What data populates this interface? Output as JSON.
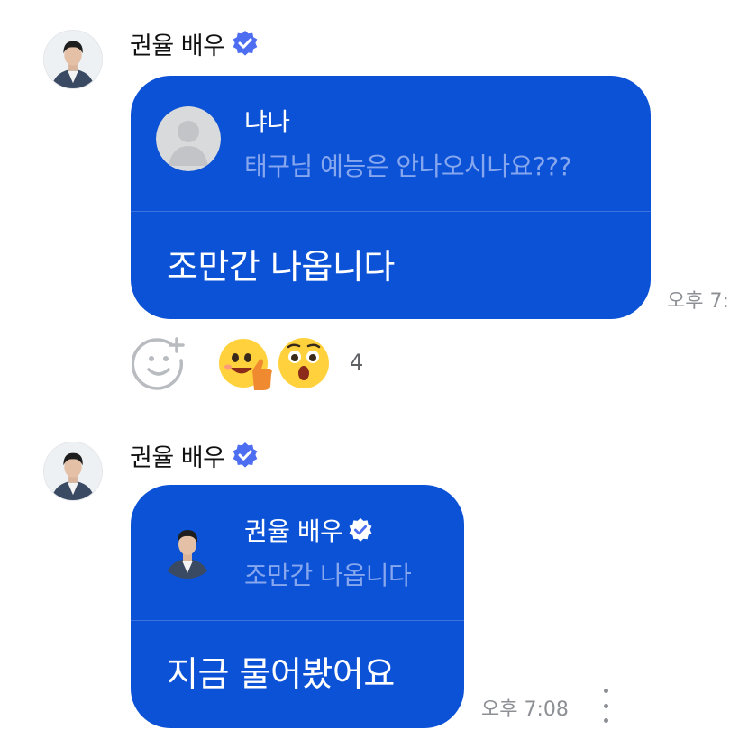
{
  "messages": [
    {
      "sender": "권율 배우",
      "quote": {
        "author": "냐나",
        "text": "태구님 예능은 안나오시나요???"
      },
      "reply": "조만간 나옵니다",
      "time": "오후 7:",
      "reactions": {
        "emojis": [
          "thumbs-up-face",
          "surprised-face"
        ],
        "count": "4"
      }
    },
    {
      "sender": "권율 배우",
      "quote": {
        "author": "권율 배우",
        "text": "조만간 나옵니다"
      },
      "reply": "지금 물어봤어요",
      "time": "오후 7:08"
    }
  ],
  "colors": {
    "bubble": "#0c52d6",
    "quote_text": "#86a6ee",
    "verified": "#4e6ef2",
    "timestamp": "#8c8f94"
  },
  "icons": [
    "verified-badge-icon",
    "add-reaction-icon",
    "more-options-icon"
  ]
}
